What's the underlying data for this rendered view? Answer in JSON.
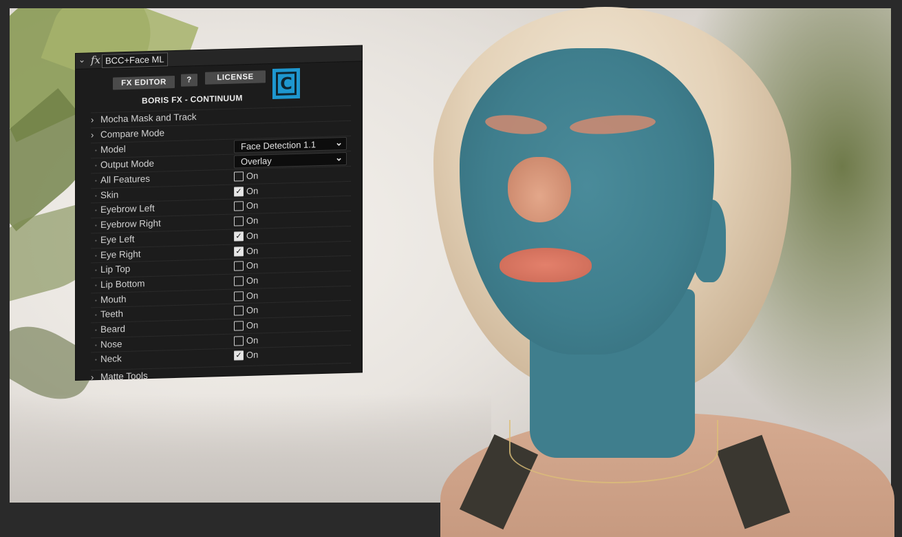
{
  "panel": {
    "effect_name": "BCC+Face ML",
    "fx_icon": "fx-icon",
    "buttons": {
      "fx_editor": "FX EDITOR",
      "help": "?",
      "license": "LICENSE"
    },
    "logo_letter": "C",
    "brand": "BORIS FX - CONTINUUM",
    "accent_color": "#1e97cf",
    "groups": {
      "mocha": "Mocha Mask and Track",
      "compare": "Compare Mode",
      "matte": "Matte Tools"
    },
    "model": {
      "label": "Model",
      "value": "Face Detection 1.1"
    },
    "output_mode": {
      "label": "Output Mode",
      "value": "Overlay"
    },
    "features": [
      {
        "label": "All Features",
        "checked": false,
        "state": "On"
      },
      {
        "label": "Skin",
        "checked": true,
        "state": "On"
      },
      {
        "label": "Eyebrow Left",
        "checked": false,
        "state": "On"
      },
      {
        "label": "Eyebrow Right",
        "checked": false,
        "state": "On"
      },
      {
        "label": "Eye Left",
        "checked": true,
        "state": "On"
      },
      {
        "label": "Eye Right",
        "checked": true,
        "state": "On"
      },
      {
        "label": "Lip Top",
        "checked": false,
        "state": "On"
      },
      {
        "label": "Lip Bottom",
        "checked": false,
        "state": "On"
      },
      {
        "label": "Mouth",
        "checked": false,
        "state": "On"
      },
      {
        "label": "Teeth",
        "checked": false,
        "state": "On"
      },
      {
        "label": "Beard",
        "checked": false,
        "state": "On"
      },
      {
        "label": "Nose",
        "checked": false,
        "state": "On"
      },
      {
        "label": "Neck",
        "checked": true,
        "state": "On"
      }
    ]
  }
}
